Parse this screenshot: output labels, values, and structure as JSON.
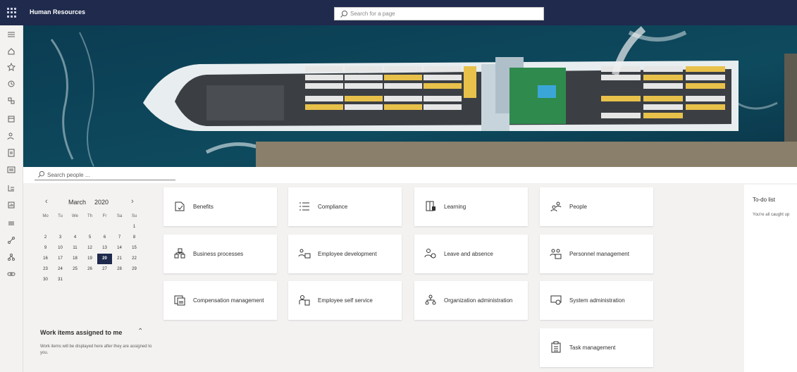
{
  "app": {
    "title": "Human Resources"
  },
  "search": {
    "placeholder": "Search for a page"
  },
  "people_search": {
    "placeholder": "Search people ..."
  },
  "calendar": {
    "month": "March",
    "year": "2020",
    "weekdays": [
      "Mo",
      "Tu",
      "We",
      "Th",
      "Fr",
      "Sa",
      "Su"
    ],
    "days": [
      "",
      "",
      "",
      "",
      "",
      "",
      "1",
      "2",
      "3",
      "4",
      "5",
      "6",
      "7",
      "8",
      "9",
      "10",
      "11",
      "12",
      "13",
      "14",
      "15",
      "16",
      "17",
      "18",
      "19",
      "20",
      "21",
      "22",
      "23",
      "24",
      "25",
      "26",
      "27",
      "28",
      "29",
      "30",
      "31"
    ],
    "selected_day": "20"
  },
  "work_items": {
    "title": "Work items assigned to me",
    "description": "Work items will be displayed here after they are assigned to you."
  },
  "tiles": [
    {
      "label": "Benefits",
      "icon": "benefits-icon"
    },
    {
      "label": "Compliance",
      "icon": "compliance-icon"
    },
    {
      "label": "Learning",
      "icon": "learning-icon"
    },
    {
      "label": "People",
      "icon": "people-icon"
    },
    {
      "label": "Business processes",
      "icon": "business-processes-icon"
    },
    {
      "label": "Employee development",
      "icon": "employee-development-icon"
    },
    {
      "label": "Leave and absence",
      "icon": "leave-absence-icon"
    },
    {
      "label": "Personnel management",
      "icon": "personnel-management-icon"
    },
    {
      "label": "Compensation management",
      "icon": "compensation-icon"
    },
    {
      "label": "Employee self service",
      "icon": "self-service-icon"
    },
    {
      "label": "Organization administration",
      "icon": "organization-icon"
    },
    {
      "label": "System administration",
      "icon": "system-admin-icon"
    },
    {
      "label": "Task management",
      "icon": "task-management-icon"
    }
  ],
  "todo": {
    "title": "To-do list",
    "description": "You're all caught up"
  },
  "nav_icons": [
    "hamburger-icon",
    "home-icon",
    "star-icon",
    "recent-icon",
    "workspace-icon",
    "modules-icon",
    "person-icon",
    "document-icon",
    "list-icon",
    "org-icon",
    "report-icon",
    "menu-icon",
    "share-icon",
    "hierarchy-icon",
    "link-icon"
  ],
  "colors": {
    "topbar": "#1f2a4d",
    "accent": "#1f2a4d",
    "background": "#f3f2f1"
  }
}
